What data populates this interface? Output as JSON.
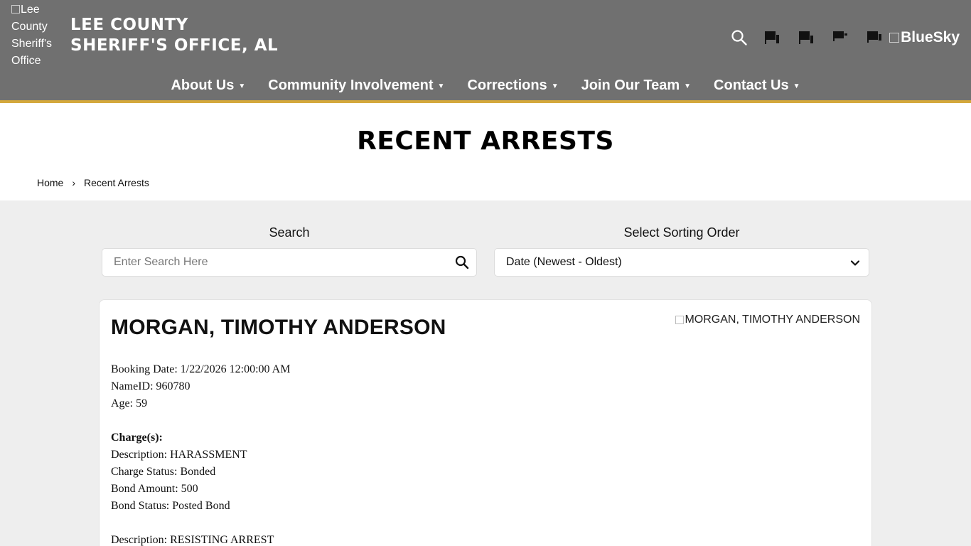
{
  "header": {
    "logo_alt": "Lee County Sheriff's Office",
    "site_title": "LEE COUNTY\nSHERIFF'S OFFICE, AL",
    "bluesky_alt": "BlueSky",
    "social_icons": [
      "facebook-icon",
      "twitter-icon",
      "youtube-icon",
      "instagram-icon"
    ],
    "accent_color": "#d4a83c",
    "background_color": "#707070"
  },
  "nav": {
    "items": [
      {
        "label": "About Us"
      },
      {
        "label": "Community Involvement"
      },
      {
        "label": "Corrections"
      },
      {
        "label": "Join Our Team"
      },
      {
        "label": "Contact Us"
      }
    ]
  },
  "page": {
    "title": "RECENT ARRESTS"
  },
  "breadcrumb": {
    "home": "Home",
    "separator": "›",
    "current": "Recent Arrests"
  },
  "filters": {
    "search_label": "Search",
    "search_placeholder": "Enter Search Here",
    "sort_label": "Select Sorting Order",
    "sort_value": "Date (Newest - Oldest)"
  },
  "record": {
    "name": "MORGAN, TIMOTHY ANDERSON",
    "photo_alt": "MORGAN, TIMOTHY ANDERSON",
    "booking_date": "Booking Date: 1/22/2026 12:00:00 AM",
    "name_id": "NameID: 960780",
    "age": "Age: 59",
    "charges_heading": "Charge(s):",
    "charges": [
      {
        "description": "Description: HARASSMENT",
        "status": "Charge Status: Bonded",
        "bond_amount": "Bond Amount: 500",
        "bond_status": "Bond Status: Posted Bond"
      },
      {
        "description": "Description: RESISTING ARREST"
      }
    ]
  }
}
